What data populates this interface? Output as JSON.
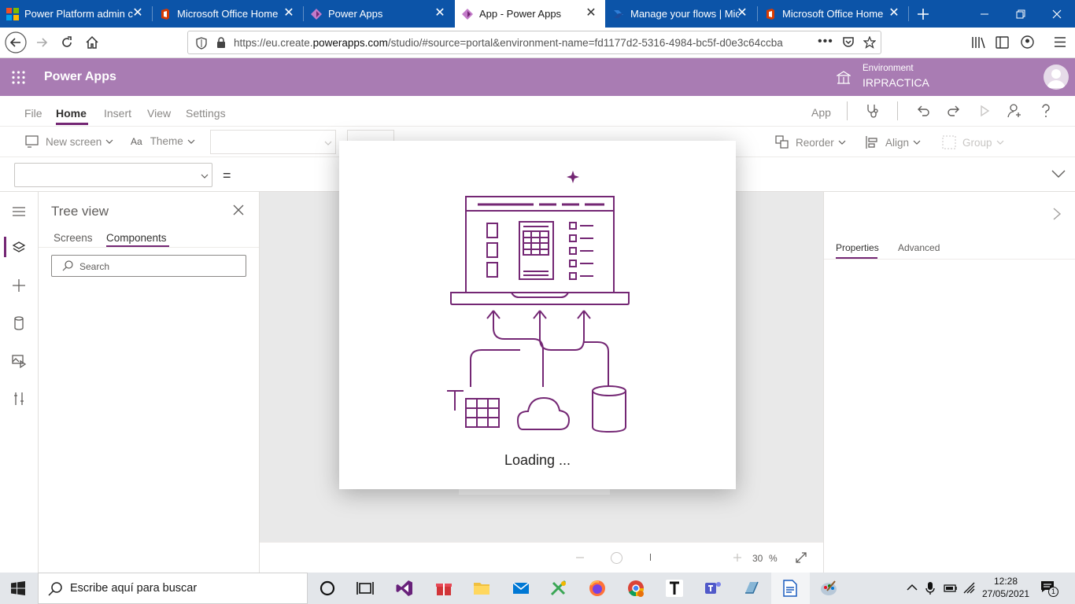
{
  "browser": {
    "tabs": [
      {
        "title": "Power Platform admin ce",
        "icon": "power-platform-icon"
      },
      {
        "title": "Microsoft Office Home",
        "icon": "office-icon"
      },
      {
        "title": "Power Apps",
        "icon": "power-apps-icon"
      },
      {
        "title": "App - Power Apps",
        "icon": "power-apps-icon",
        "active": true
      },
      {
        "title": "Manage your flows | Mic",
        "icon": "power-automate-icon"
      },
      {
        "title": "Microsoft Office Home",
        "icon": "office-icon"
      }
    ],
    "url_prefix": "https://eu.create.",
    "url_domain": "powerapps.com",
    "url_suffix": "/studio/#source=portal&environment-name=fd1177d2-5316-4984-bc5f-d0e3c64ccba"
  },
  "app": {
    "title": "Power Apps",
    "environment_label": "Environment",
    "environment_name": "IRPRACTICA",
    "accent": "#a97cb3",
    "brand": "#742774"
  },
  "menu": {
    "items": [
      "File",
      "Home",
      "Insert",
      "View",
      "Settings"
    ],
    "active": "Home",
    "right_label": "App"
  },
  "ribbon": {
    "new_screen": "New screen",
    "theme": "Theme",
    "reorder": "Reorder",
    "align": "Align",
    "group": "Group"
  },
  "formula": {
    "equals": "="
  },
  "tree": {
    "title": "Tree view",
    "tabs": [
      "Screens",
      "Components"
    ],
    "active_tab": "Components",
    "search_placeholder": "Search"
  },
  "properties": {
    "tabs": [
      "Properties",
      "Advanced"
    ],
    "active_tab": "Properties"
  },
  "canvas": {
    "zoom_value": "30",
    "zoom_unit": "%"
  },
  "dialog": {
    "loading_text": "Loading ..."
  },
  "taskbar": {
    "search_text": "Escribe aquí para buscar",
    "time": "12:28",
    "date": "27/05/2021",
    "notification_count": "1"
  }
}
